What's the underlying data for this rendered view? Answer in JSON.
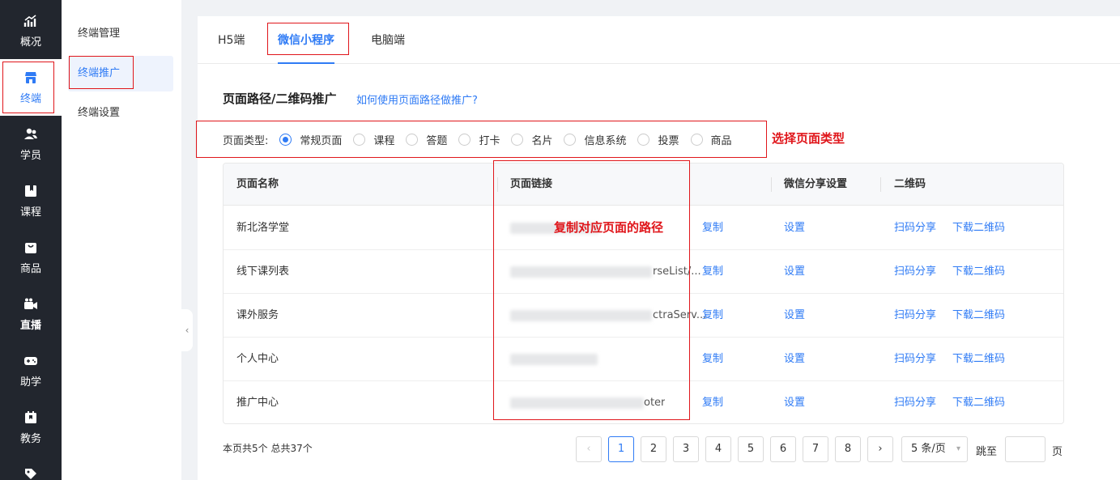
{
  "nav": {
    "items": [
      {
        "label": "概况",
        "icon": "chart-trend-icon"
      },
      {
        "label": "终端",
        "icon": "storefront-icon"
      },
      {
        "label": "学员",
        "icon": "users-icon"
      },
      {
        "label": "课程",
        "icon": "book-icon"
      },
      {
        "label": "商品",
        "icon": "bag-icon"
      },
      {
        "label": "直播",
        "icon": "video-camera-icon"
      },
      {
        "label": "助学",
        "icon": "gamepad-icon"
      },
      {
        "label": "教务",
        "icon": "calendar-icon"
      }
    ]
  },
  "subnav": {
    "items": [
      {
        "label": "终端管理"
      },
      {
        "label": "终端推广"
      },
      {
        "label": "终端设置"
      }
    ]
  },
  "tabs": [
    "H5端",
    "微信小程序",
    "电脑端"
  ],
  "section": {
    "title": "页面路径/二维码推广",
    "help_link": "如何使用页面路径做推广?"
  },
  "page_type": {
    "label": "页面类型:",
    "options": [
      "常规页面",
      "课程",
      "答题",
      "打卡",
      "名片",
      "信息系统",
      "投票",
      "商品"
    ],
    "selected": "常规页面"
  },
  "annotations": {
    "select_type": "选择页面类型",
    "copy_path": "复制对应页面的路径"
  },
  "table": {
    "headers": {
      "name": "页面名称",
      "link": "页面链接",
      "share": "微信分享设置",
      "qrcode": "二维码"
    },
    "rows": [
      {
        "name": "新北洛学堂",
        "path_suffix": "",
        "copy": "复制",
        "share": "设置",
        "scan": "扫码分享",
        "download": "下载二维码"
      },
      {
        "name": "线下课列表",
        "path_suffix": "rseList/...",
        "copy": "复制",
        "share": "设置",
        "scan": "扫码分享",
        "download": "下载二维码"
      },
      {
        "name": "课外服务",
        "path_suffix": "ctraServ...",
        "copy": "复制",
        "share": "设置",
        "scan": "扫码分享",
        "download": "下载二维码"
      },
      {
        "name": "个人中心",
        "path_suffix": "",
        "copy": "复制",
        "share": "设置",
        "scan": "扫码分享",
        "download": "下载二维码"
      },
      {
        "name": "推广中心",
        "path_suffix": "oter",
        "copy": "复制",
        "share": "设置",
        "scan": "扫码分享",
        "download": "下载二维码"
      }
    ]
  },
  "footer": {
    "summary": "本页共5个 总共37个",
    "pages": [
      "1",
      "2",
      "3",
      "4",
      "5",
      "6",
      "7",
      "8"
    ],
    "current_page": "1",
    "prev": "‹",
    "next": "›",
    "page_size": "5 条/页",
    "jump_label": "跳至",
    "jump_unit": "页"
  },
  "colors": {
    "accent": "#2f7bf5",
    "nav_bg": "#22262e",
    "annotation_red": "#e0161b"
  }
}
